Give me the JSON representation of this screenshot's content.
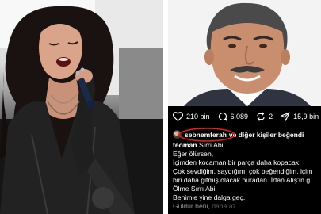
{
  "post": {
    "actions": [
      {
        "icon": "heart-icon",
        "count": "210 bin"
      },
      {
        "icon": "comment-icon",
        "count": "6.089"
      },
      {
        "icon": "repost-icon",
        "count": "2"
      },
      {
        "icon": "share-icon",
        "count": "15,9 bin"
      }
    ],
    "likes": {
      "user": "sebnemferah",
      "rest": "ve diğer kişiler beğendi",
      "highlight_color": "#e02020"
    },
    "caption": {
      "user": "teoman",
      "first_line": "Sırrı Abi.",
      "lines": [
        "Eğer ölürsen,",
        "İçimden kocaman bir parça daha kopacak.",
        "Çok sevdiğim, saydığım, çok beğendiğim, içim",
        "biri daha gitmiş olacak buradan. İrfan Alış'ın g",
        "Ölme Sırrı Abi.",
        "Benimle yine dalga geç."
      ],
      "last_line": "Güldür beni,",
      "more": "daha az"
    }
  }
}
